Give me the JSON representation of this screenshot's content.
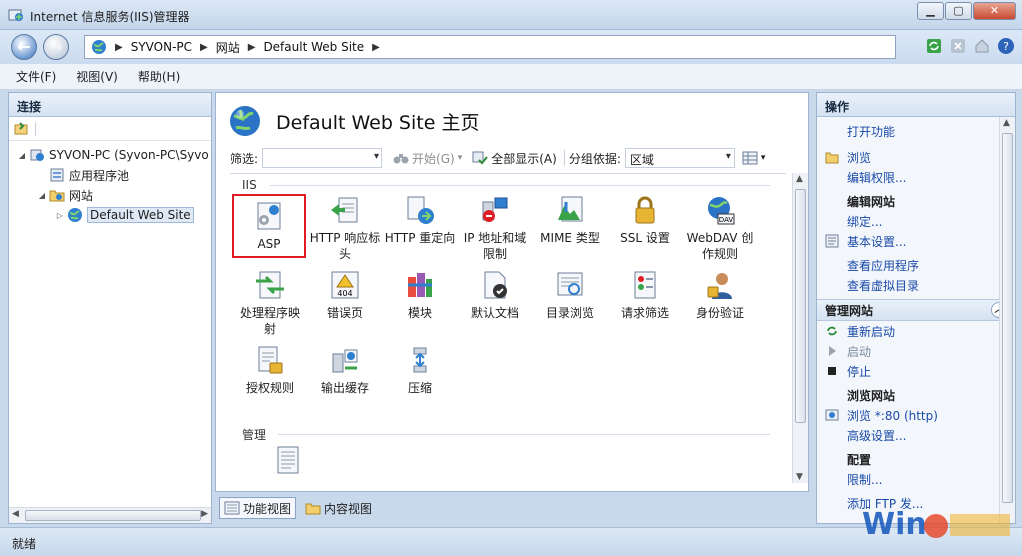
{
  "window": {
    "title": "Internet 信息服务(IIS)管理器"
  },
  "address": {
    "crumbs": [
      "SYVON-PC",
      "网站",
      "Default Web Site"
    ]
  },
  "menu": {
    "file": "文件(F)",
    "view": "视图(V)",
    "help": "帮助(H)"
  },
  "left": {
    "header": "连接",
    "tree": {
      "server": "SYVON-PC (Syvon-PC\\Syvo",
      "apppools": "应用程序池",
      "sites": "网站",
      "site": "Default Web Site"
    }
  },
  "center": {
    "title": "Default Web Site 主页",
    "filter_label": "筛选:",
    "start": "开始(G)",
    "show_all": "全部显示(A)",
    "group_by": "分组依据:",
    "group_value": "区域",
    "sections": {
      "iis": "IIS",
      "manage": "管理"
    },
    "features": [
      {
        "l1": "ASP",
        "l2": ""
      },
      {
        "l1": "HTTP 响应标",
        "l2": "头"
      },
      {
        "l1": "HTTP 重定向",
        "l2": ""
      },
      {
        "l1": "IP 地址和域",
        "l2": "限制"
      },
      {
        "l1": "MIME 类型",
        "l2": ""
      },
      {
        "l1": "SSL 设置",
        "l2": ""
      },
      {
        "l1": "WebDAV 创",
        "l2": "作规则"
      },
      {
        "l1": "处理程序映",
        "l2": "射"
      },
      {
        "l1": "错误页",
        "l2": ""
      },
      {
        "l1": "模块",
        "l2": ""
      },
      {
        "l1": "默认文档",
        "l2": ""
      },
      {
        "l1": "目录浏览",
        "l2": ""
      },
      {
        "l1": "请求筛选",
        "l2": ""
      },
      {
        "l1": "身份验证",
        "l2": ""
      },
      {
        "l1": "授权规则",
        "l2": ""
      },
      {
        "l1": "输出缓存",
        "l2": ""
      },
      {
        "l1": "压缩",
        "l2": ""
      }
    ],
    "views": {
      "features": "功能视图",
      "content": "内容视图"
    }
  },
  "right": {
    "header": "操作",
    "open_feature": "打开功能",
    "browse": "浏览",
    "edit_perms": "编辑权限...",
    "edit_site": "编辑网站",
    "bindings": "绑定...",
    "basic_settings": "基本设置...",
    "view_apps": "查看应用程序",
    "view_vdirs": "查看虚拟目录",
    "manage_site": "管理网站",
    "restart": "重新启动",
    "start": "启动",
    "stop": "停止",
    "browse_site": "浏览网站",
    "browse_80": "浏览 *:80 (http)",
    "advanced": "高级设置...",
    "config": "配置",
    "limits": "限制...",
    "add_ftp": "添加 FTP 发..."
  },
  "status": {
    "text": "就绪"
  },
  "colors": {
    "selection_border": "#e01c24",
    "link": "#1a4aa8"
  }
}
